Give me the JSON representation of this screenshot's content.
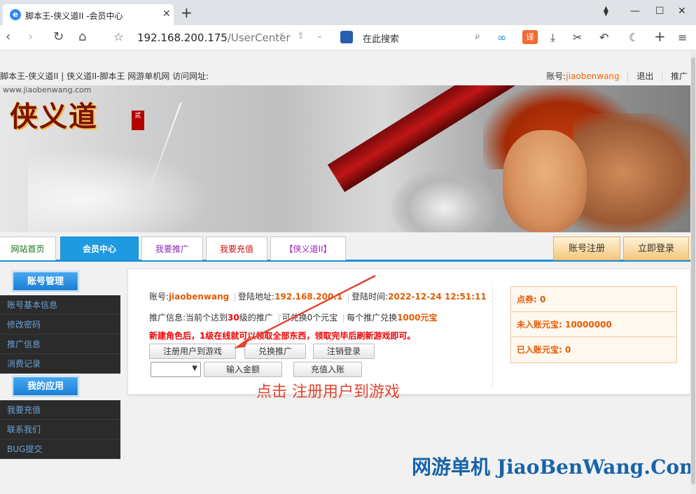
{
  "browser": {
    "tab_icon": "e",
    "tab_title": "脚本王-侠义道II -会员中心",
    "tab_close": "✕",
    "new_tab": "+",
    "url_host": "192.168.200.175",
    "url_path": "/UserCenter",
    "search_placeholder": "在此搜索",
    "paw_icon": "🐾",
    "translate_label": "译"
  },
  "site_header": {
    "left_text": "脚本王-侠义道II | 侠义道II-脚本王 网游单机网 访问网址:",
    "account_label": "账号:",
    "account_name": "jiaobenwang",
    "logout": "退出",
    "promote": "推广"
  },
  "banner": {
    "url_text": "www.jiaobenwang.com",
    "logo_text": "侠义道",
    "seal_text": "贰"
  },
  "menu": {
    "tabs": [
      {
        "label": "网站首页"
      },
      {
        "label": "会员中心"
      },
      {
        "label": "我要推广"
      },
      {
        "label": "我要充值"
      },
      {
        "label": "【侠义道II】"
      }
    ],
    "register": "账号注册",
    "login": "立即登录"
  },
  "sidebar": {
    "account_head": "账号管理",
    "account_items": [
      {
        "label": "账号基本信息"
      },
      {
        "label": "修改密码"
      },
      {
        "label": "推广信息"
      },
      {
        "label": "消费记录"
      }
    ],
    "apps_head": "我的应用",
    "apps_items": [
      {
        "label": "我要充值"
      },
      {
        "label": "联系我们"
      },
      {
        "label": "BUG提交"
      }
    ]
  },
  "panel": {
    "account_label": "账号:",
    "account_value": "jiaobenwang",
    "login_addr_label": "登陆地址:",
    "login_addr_value": "192.168.200.1",
    "login_time_label": "登陆时间:",
    "login_time_value": "2022-12-24 12:51:11",
    "promo_label": "推广信息:当前个达到",
    "promo_level": "30",
    "promo_mid": "级的推广",
    "promo_exchange": "可兑换0个元宝",
    "promo_each": "每个推广兑换",
    "promo_each_value": "1000元宝",
    "notice": "新建角色后，1级在线就可以领取全部东西，领取完毕后刷新游戏即可。",
    "btn_register_game": "注册用户到游戏",
    "btn_exchange": "兑换推广",
    "btn_logout": "注销登录",
    "btn_input_amount": "输入金额",
    "btn_recharge": "充值入账",
    "select_value": ""
  },
  "stats": {
    "coupon": "点券:  0",
    "pending_yuanbao": "未入账元宝:  10000000",
    "credited_yuanbao": "已入账元宝:  0"
  },
  "annotation": {
    "caption": "点击  注册用户到游戏",
    "watermark": "网游单机 JiaoBenWang.Com"
  }
}
